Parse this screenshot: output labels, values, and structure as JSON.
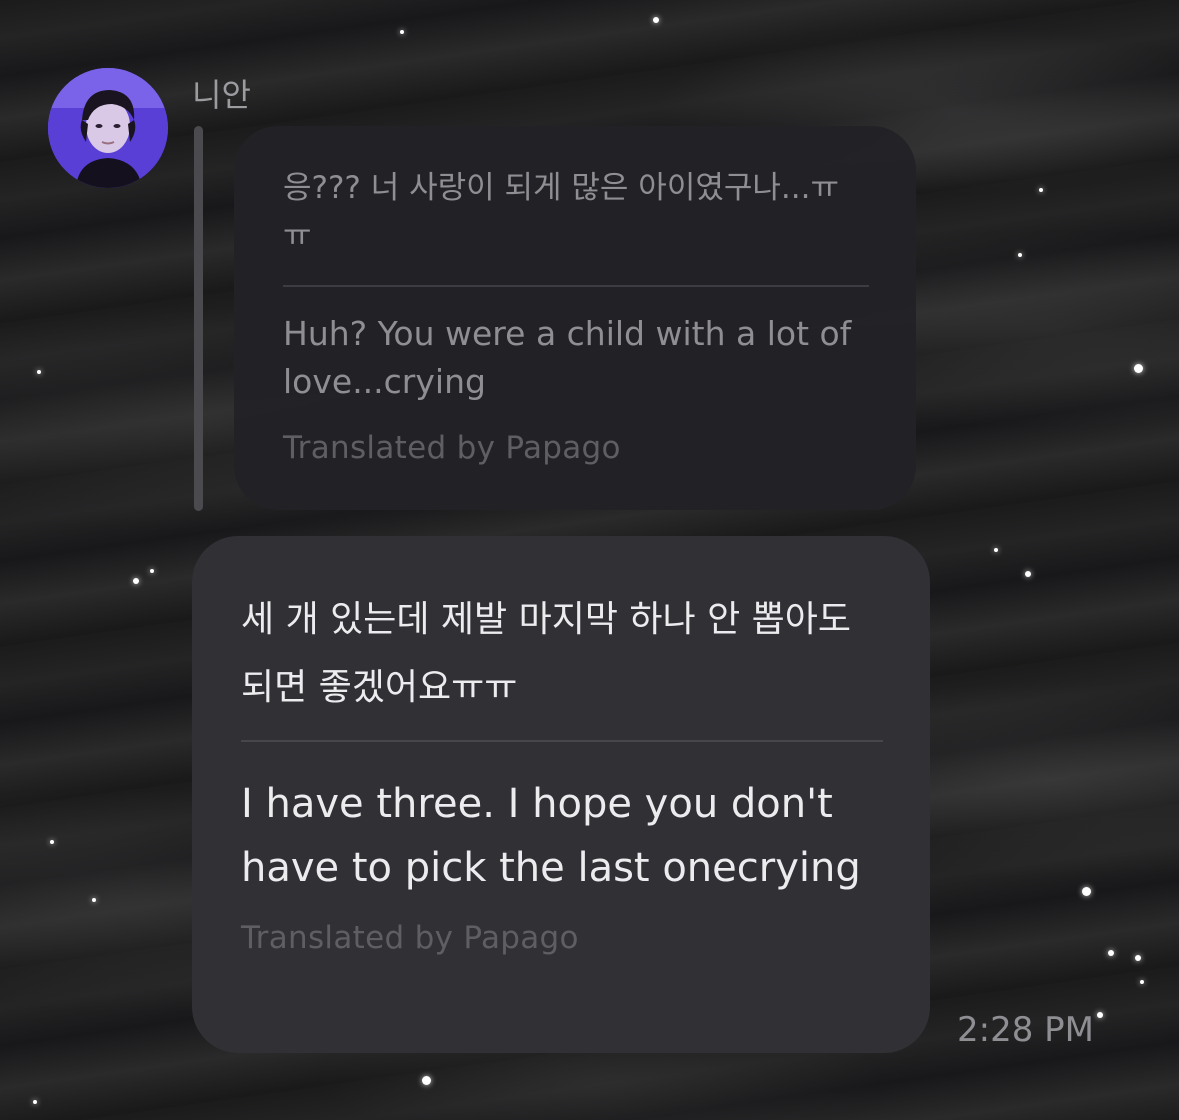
{
  "conversation": {
    "sender": {
      "name": "니안",
      "avatar": "user-avatar-photo"
    },
    "quoted_message": {
      "original": "응??? 너 사랑이 되게 많은 아이였구나...ㅠㅠ",
      "translation": "Huh? You were a child with a lot of love...crying",
      "credit": "Translated by Papago"
    },
    "message": {
      "original": "세 개 있는데 제발 마지막 하나 안 뽑아도 되면 좋겠어요ㅠㅠ",
      "translation": "I have three. I hope you don't have to pick the last onecrying",
      "credit": "Translated by Papago"
    },
    "timestamp": "2:28 PM"
  },
  "colors": {
    "quoted_bubble": "#222226",
    "main_bubble": "#303035",
    "primary_text": "#ececee",
    "secondary_text": "#8e8e93",
    "credit_text": "#5e5e63",
    "avatar_accent": "#7b5cf0"
  }
}
